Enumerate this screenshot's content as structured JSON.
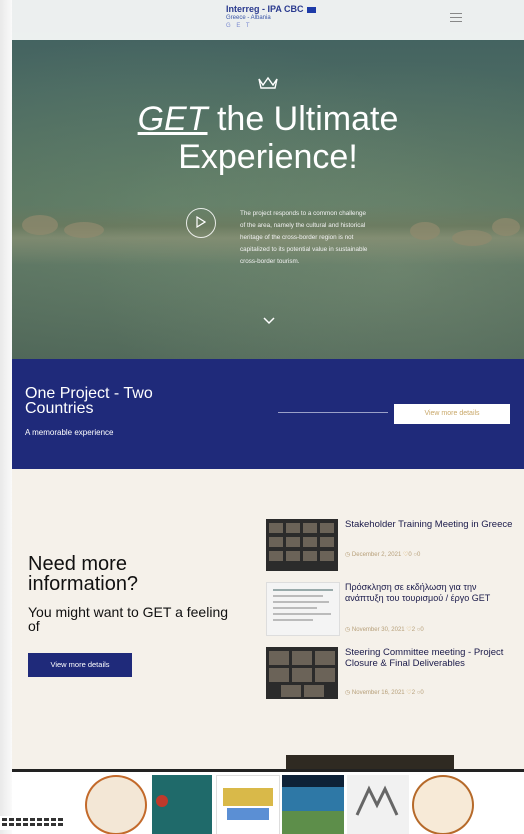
{
  "header": {
    "logo_line1": "Interreg - IPA CBC",
    "logo_line2": "Greece - Albania",
    "logo_line3": "G E T",
    "menu_icon": "hamburger-menu-icon"
  },
  "hero": {
    "title_highlight": "GET",
    "title_rest": " the Ultimate",
    "title_line2": "Experience!",
    "description": "The project responds to a common challenge of the area, namely the cultural and historical heritage of the cross-border region is not capitalized to its potential value in sustainable cross-border tourism.",
    "play_icon": "play-icon",
    "scroll_icon": "chevron-down-icon",
    "crown_icon": "crown-icon"
  },
  "band": {
    "title": "One Project - Two Countries",
    "subtitle": "A memorable experience",
    "button": "View more details"
  },
  "info": {
    "heading": "Need more information?",
    "text": "You might want to GET a feeling of",
    "button": "View more details"
  },
  "posts": [
    {
      "title": "Stakeholder Training Meeting in Greece",
      "date": "December 2, 2021",
      "likes": "0",
      "comments": "0"
    },
    {
      "title": "Πρόσκληση σε εκδήλωση για την ανάπτυξη του τουρισμού / έργο GET",
      "date": "November 30, 2021",
      "likes": "2",
      "comments": "0"
    },
    {
      "title": "Steering Committee meeting - Project Closure & Final Deliverables",
      "date": "November 16, 2021",
      "likes": "2",
      "comments": "0"
    }
  ],
  "partner_logos": [
    "university-seal-logo",
    "albanian-emblem-logo",
    "get-routes-logo",
    "welcome-tourism-logo",
    "museum-logo",
    "cultural-association-logo"
  ],
  "colors": {
    "navy": "#1f2a7a",
    "gold": "#c9a86a",
    "beige": "#f5f1ea"
  }
}
